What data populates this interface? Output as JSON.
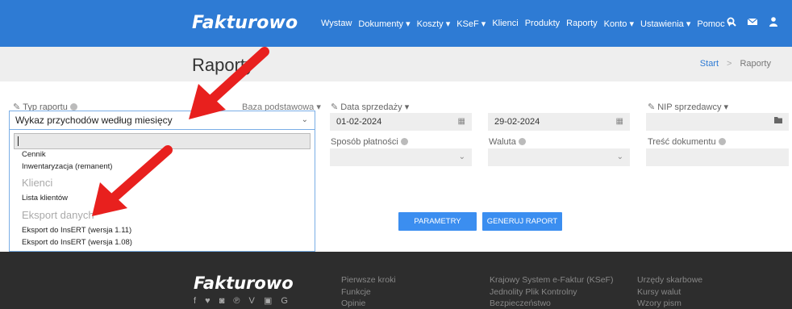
{
  "brand": {
    "name": "Fakturowo"
  },
  "nav": {
    "items": [
      "Wystaw",
      "Dokumenty ▾",
      "Koszty ▾",
      "KSeF ▾",
      "Klienci",
      "Produkty",
      "Raporty",
      "Konto ▾",
      "Ustawienia ▾",
      "Pomoc ▾"
    ],
    "icons": [
      "search-icon",
      "envelope-icon",
      "user-icon"
    ]
  },
  "page": {
    "title": "Raporty",
    "breadcrumb": {
      "start": "Start",
      "sep": ">",
      "current": "Raporty"
    }
  },
  "form": {
    "report_type": {
      "label": "Typ raportu",
      "base_label": "Baza podstawowa ▾",
      "value": "Wykaz przychodów według miesięcy"
    },
    "dropdown": {
      "search_value": "",
      "options": [
        {
          "kind": "option",
          "text": "Cennik"
        },
        {
          "kind": "option",
          "text": "Inwentaryzacja (remanent)"
        },
        {
          "kind": "group",
          "text": "Klienci"
        },
        {
          "kind": "option",
          "text": "Lista klientów"
        },
        {
          "kind": "group",
          "text": "Eksport danych"
        },
        {
          "kind": "option",
          "text": "Eksport do InsERT (wersja 1.11)"
        },
        {
          "kind": "option",
          "text": "Eksport do InsERT (wersja 1.08)"
        }
      ]
    },
    "sale_date": {
      "label": "Data sprzedaży ▾",
      "from": "01-02-2024",
      "to": "29-02-2024"
    },
    "seller_nip": {
      "label": "NIP sprzedawcy ▾",
      "value": ""
    },
    "payment_method": {
      "label": "Sposób płatności",
      "value": ""
    },
    "currency": {
      "label": "Waluta",
      "value": ""
    },
    "content": {
      "label": "Treść dokumentu",
      "value": ""
    },
    "buttons": {
      "params": "PARAMETRY",
      "generate": "GENERUJ RAPORT"
    }
  },
  "footer": {
    "brand": "Fakturowo",
    "social": "f ♥ ◙ ℗ V ▣ G",
    "col1": [
      "Pierwsze kroki",
      "Funkcje",
      "Opinie"
    ],
    "col2": [
      "Krajowy System e-Faktur (KSeF)",
      "Jednolity Plik Kontrolny",
      "Bezpieczeństwo"
    ],
    "col3": [
      "Urzędy skarbowe",
      "Kursy walut",
      "Wzory pism"
    ]
  },
  "colors": {
    "nav_bg": "#2e7bd4",
    "accent_button": "#3b8ef0",
    "footer_bg": "#2d2d2d",
    "annotation_arrow": "#e8201e"
  }
}
